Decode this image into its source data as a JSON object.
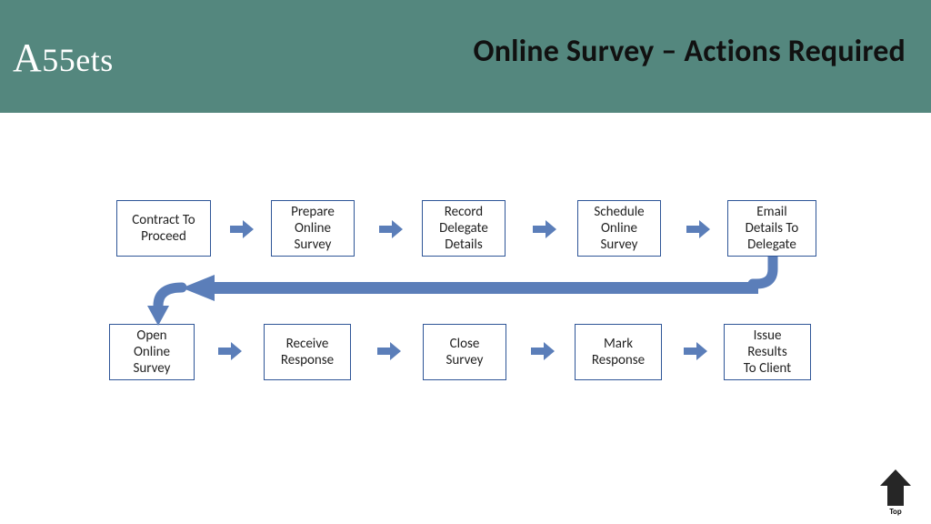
{
  "header": {
    "logo_text": "A55ets",
    "title": "Online Survey – Actions Required"
  },
  "colors": {
    "header_bg": "#54877e",
    "box_border": "#2e5597",
    "arrow_fill": "#5b7eb9",
    "top_btn": "#262626"
  },
  "flow": {
    "row1": [
      {
        "label": "Contract To\nProceed"
      },
      {
        "label": "Prepare\nOnline\nSurvey"
      },
      {
        "label": "Record\nDelegate\nDetails"
      },
      {
        "label": "Schedule\nOnline\nSurvey"
      },
      {
        "label": "Email\nDetails To\nDelegate"
      }
    ],
    "row2": [
      {
        "label": "Open\nOnline\nSurvey"
      },
      {
        "label": "Receive\nResponse"
      },
      {
        "label": "Close\nSurvey"
      },
      {
        "label": "Mark\nResponse"
      },
      {
        "label": "Issue\nResults\nTo Client"
      }
    ]
  },
  "nav": {
    "top_label": "Top"
  }
}
